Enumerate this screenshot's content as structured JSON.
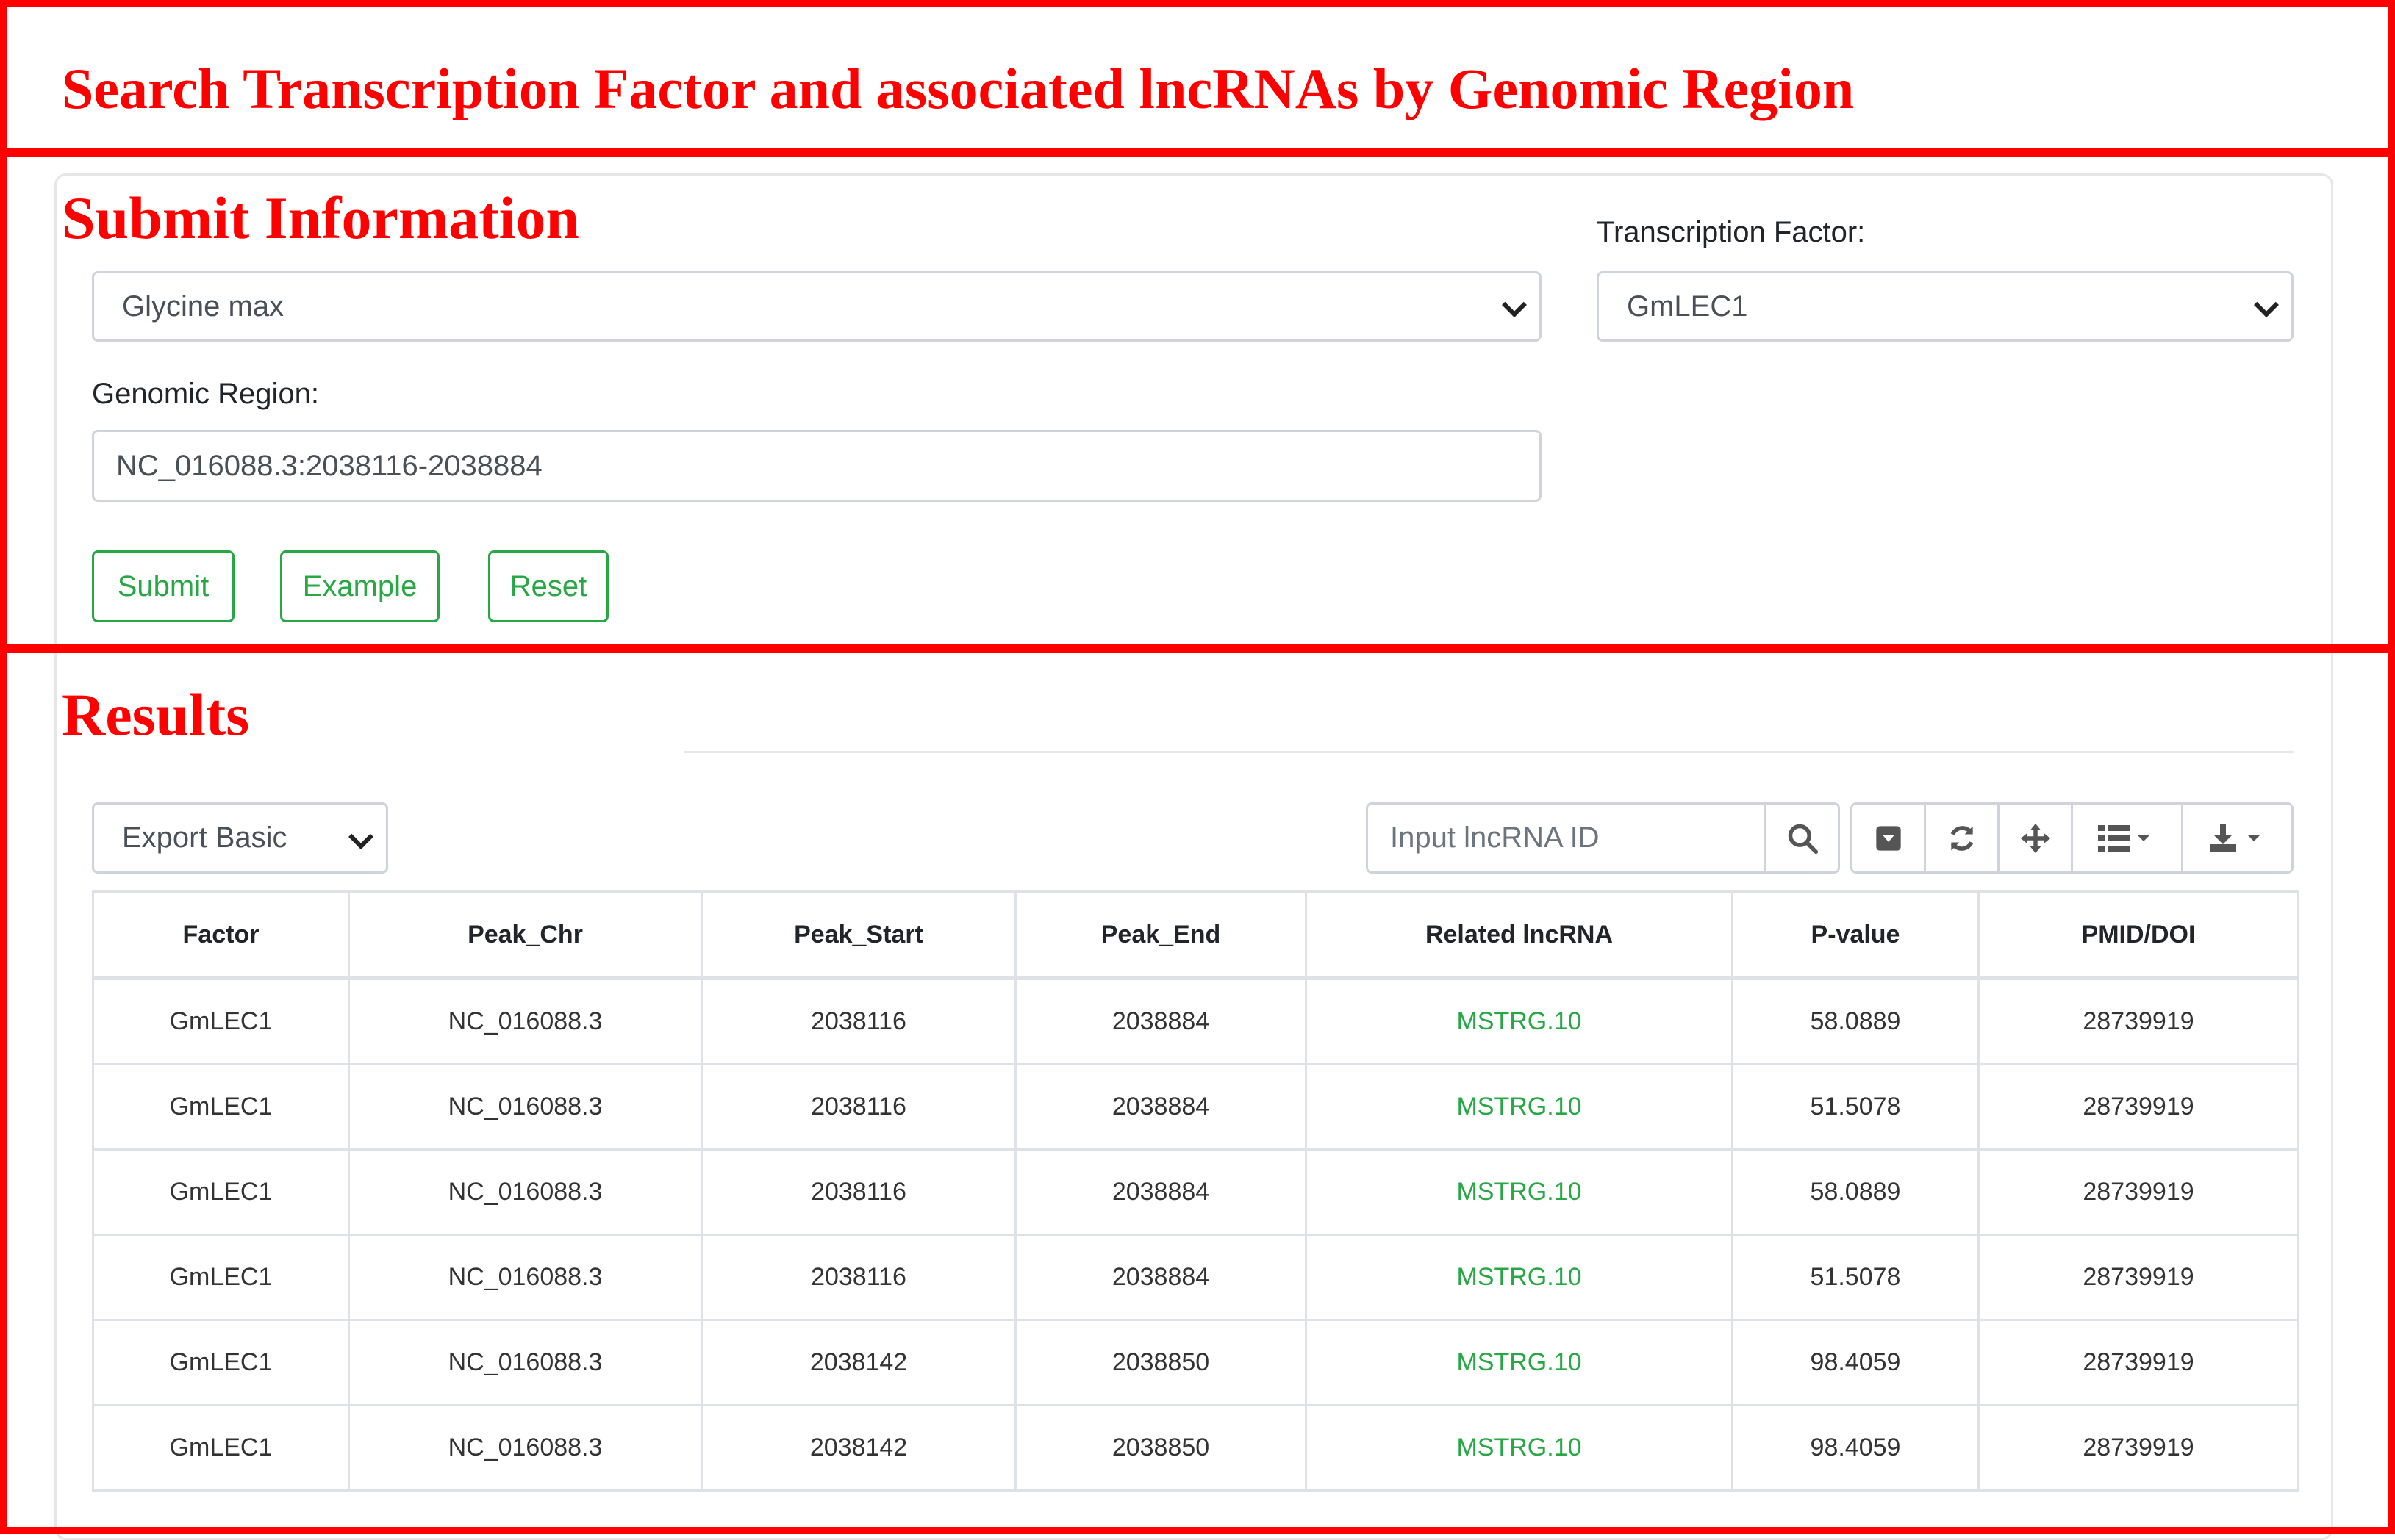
{
  "annotations": {
    "title": "Search Transcription Factor and associated lncRNAs by Genomic Region",
    "submit_section": "Submit Information",
    "results_section": "Results"
  },
  "form": {
    "species_select_value": "Glycine max",
    "tf_label": "Transcription Factor:",
    "tf_select_value": "GmLEC1",
    "region_label": "Genomic Region:",
    "region_value": "NC_016088.3:2038116-2038884",
    "buttons": {
      "submit": "Submit",
      "example": "Example",
      "reset": "Reset"
    }
  },
  "results": {
    "export_select_value": "Export Basic",
    "search_placeholder": "Input lncRNA ID",
    "toolbar_icons": [
      "search-icon",
      "toggle-icon",
      "refresh-icon",
      "fullscreen-icon",
      "columns-icon",
      "download-icon"
    ],
    "columns": [
      "Factor",
      "Peak_Chr",
      "Peak_Start",
      "Peak_End",
      "Related lncRNA",
      "P-value",
      "PMID/DOI"
    ],
    "rows": [
      [
        "GmLEC1",
        "NC_016088.3",
        "2038116",
        "2038884",
        "MSTRG.10",
        "58.0889",
        "28739919"
      ],
      [
        "GmLEC1",
        "NC_016088.3",
        "2038116",
        "2038884",
        "MSTRG.10",
        "51.5078",
        "28739919"
      ],
      [
        "GmLEC1",
        "NC_016088.3",
        "2038116",
        "2038884",
        "MSTRG.10",
        "58.0889",
        "28739919"
      ],
      [
        "GmLEC1",
        "NC_016088.3",
        "2038116",
        "2038884",
        "MSTRG.10",
        "51.5078",
        "28739919"
      ],
      [
        "GmLEC1",
        "NC_016088.3",
        "2038142",
        "2038850",
        "MSTRG.10",
        "98.4059",
        "28739919"
      ],
      [
        "GmLEC1",
        "NC_016088.3",
        "2038142",
        "2038850",
        "MSTRG.10",
        "98.4059",
        "28739919"
      ]
    ]
  },
  "colors": {
    "annotation": "#ff0000",
    "accent": "#28a745",
    "border": "#ced4da"
  }
}
